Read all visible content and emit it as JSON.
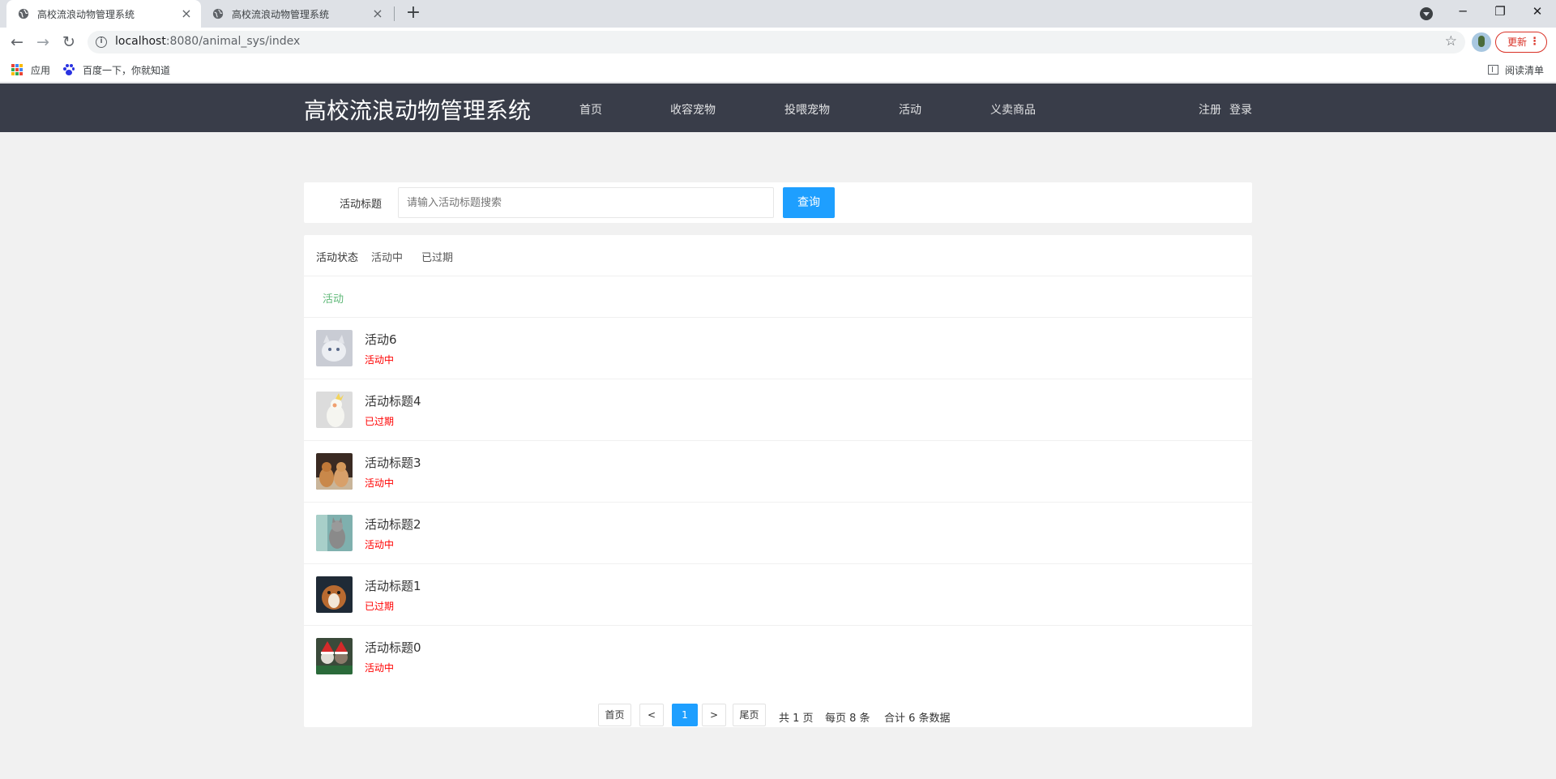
{
  "browser": {
    "tabs": [
      {
        "title": "高校流浪动物管理系统",
        "active": true
      },
      {
        "title": "高校流浪动物管理系统",
        "active": false
      }
    ],
    "url_host": "localhost",
    "url_rest": ":8080/animal_sys/index",
    "update_label": "更新",
    "bookmarks": {
      "apps": "应用",
      "baidu": "百度一下，你就知道",
      "reading_list": "阅读清单"
    }
  },
  "header": {
    "logo": "高校流浪动物管理系统",
    "nav": [
      "首页",
      "收容宠物",
      "投喂宠物",
      "活动",
      "义卖商品"
    ],
    "register": "注册",
    "login": "登录"
  },
  "search": {
    "label": "活动标题",
    "placeholder": "请输入活动标题搜索",
    "value": "",
    "button": "查询"
  },
  "filter": {
    "label": "活动状态",
    "options": [
      "活动中",
      "已过期"
    ]
  },
  "category": "活动",
  "activities": [
    {
      "title": "活动6",
      "status": "活动中",
      "status_color": "#ff0000"
    },
    {
      "title": "活动标题4",
      "status": "已过期",
      "status_color": "#ff0000"
    },
    {
      "title": "活动标题3",
      "status": "活动中",
      "status_color": "#ff0000"
    },
    {
      "title": "活动标题2",
      "status": "活动中",
      "status_color": "#ff0000"
    },
    {
      "title": "活动标题1",
      "status": "已过期",
      "status_color": "#ff0000"
    },
    {
      "title": "活动标题0",
      "status": "活动中",
      "status_color": "#ff0000"
    }
  ],
  "pagination": {
    "first": "首页",
    "prev": "<",
    "current": "1",
    "next": ">",
    "last": "尾页",
    "total_pages": "共 1 页",
    "per_page": "每页 8 条",
    "total_records": "合计 6 条数据"
  },
  "colors": {
    "header_bg": "#393d49",
    "accent": "#1e9fff",
    "category": "#5fb878",
    "status": "#ff0000"
  }
}
